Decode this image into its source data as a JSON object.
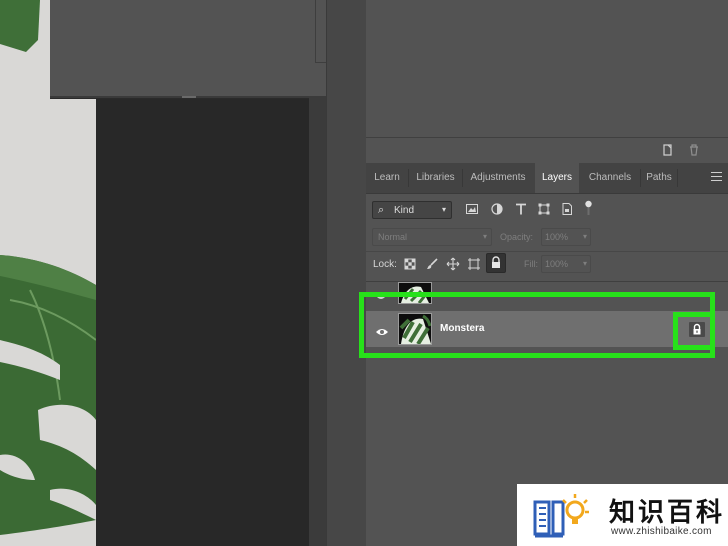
{
  "tabs": [
    "Learn",
    "Libraries",
    "Adjustments",
    "Layers",
    "Channels",
    "Paths"
  ],
  "active_tab": "Layers",
  "filter": {
    "label": "Kind"
  },
  "blend_mode": "Normal",
  "opacity": {
    "label": "Opacity:",
    "value": "100%"
  },
  "lock": {
    "label": "Lock:"
  },
  "fill": {
    "label": "Fill:",
    "value": "100%"
  },
  "layers": [
    {
      "name": "",
      "visible": true,
      "locked": false
    },
    {
      "name": "Monstera",
      "visible": true,
      "locked": true,
      "selected": true
    }
  ],
  "watermark": {
    "brand": "知识百科",
    "url": "www.zhishibaike.com"
  },
  "colors": {
    "panel_bg": "#535353",
    "tab_bar_bg": "#434343",
    "selected_layer_bg": "#6f6f6f",
    "highlight": "#27e11a",
    "leaf_green": "#3f6f38"
  },
  "icons": {
    "toolbar": [
      "new-layer-icon",
      "trash-icon"
    ],
    "filters": [
      "pixel-filter-icon",
      "adjustment-filter-icon",
      "type-filter-icon",
      "shape-filter-icon",
      "smart-object-filter-icon"
    ],
    "locks": [
      "lock-transparency-icon",
      "lock-paint-icon",
      "lock-position-icon",
      "lock-artboard-icon",
      "lock-all-icon"
    ]
  }
}
